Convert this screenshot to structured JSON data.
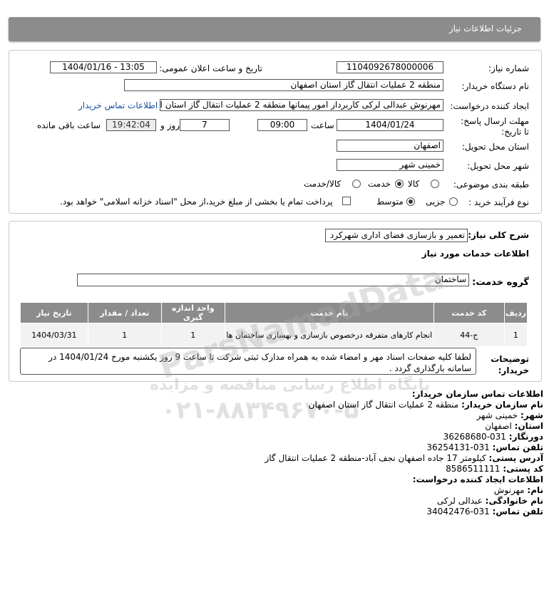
{
  "header": {
    "title": "جزئیات اطلاعات نیاز"
  },
  "form": {
    "need_number_label": "شماره نیاز:",
    "need_number": "1104092678000006",
    "announce_label": "تاریخ و ساعت اعلان عمومی:",
    "announce_value": "1404/01/16 - 13:05",
    "buyer_org_label": "نام دستگاه خریدار:",
    "buyer_org": "منطقه 2 عملیات انتقال گاز استان اصفهان",
    "creator_label": "ایجاد کننده درخواست:",
    "creator": "مهرنوش عبدالی لرکی کاربرداز امور پیمانها منطقه 2 عملیات انتقال گاز استان اص",
    "contact_link": "اطلاعات تماس خریدار",
    "deadline_label": "مهلت ارسال پاسخ: تا تاریخ:",
    "deadline_date": "1404/01/24",
    "time_label": "ساعت",
    "deadline_time": "09:00",
    "days_count": "7",
    "days_label": "روز و",
    "remaining_time": "19:42:04",
    "remaining_label": "ساعت باقی مانده",
    "province_label": "استان محل تحویل:",
    "province": "اصفهان",
    "city_label": "شهر محل تحویل:",
    "city": "خمینی شهر",
    "category_label": "طبقه بندی موضوعی:",
    "category_options": [
      "کالا",
      "خدمت",
      "کالا/خدمت"
    ],
    "category_selected": "خدمت",
    "process_label": "نوع فرآیند خرید :",
    "process_options": [
      "جزیی",
      "متوسط"
    ],
    "process_selected": "متوسط",
    "payment_text": "پرداخت تمام یا بخشی از مبلغ خرید،از محل \"اسناد خزانه اسلامی\" خواهد بود."
  },
  "summary": {
    "title_label": "شرح کلی نیاز:",
    "title_value": "تعمیر و بازسازی فضای اداری شهرکرد",
    "services_heading": "اطلاعات خدمات مورد نیاز",
    "group_label": "گروه خدمت:",
    "group_value": "ساختمان"
  },
  "table": {
    "headers": [
      "ردیف",
      "کد خدمت",
      "نام خدمت",
      "واحد اندازه گیری",
      "تعداد / مقدار",
      "تاریخ نیاز"
    ],
    "rows": [
      [
        "1",
        "ج-44",
        "انجام کارهای متفرقه درخصوص بازسازی و بهسازی ساختمان ها",
        "1",
        "1",
        "1404/03/31"
      ]
    ]
  },
  "notes": {
    "label": "توضیحات خریدار:",
    "text": "لطفا کلیه صفحات اسناد مهر و امضاء شده به همراه مدارک ثبتی شرکت تا ساعت 9 روز یکشنبه مورخ 1404/01/24 در سامانه بارگذاری گردد ."
  },
  "contact": {
    "heading": "اطلاعات تماس سازمان خریدار:",
    "org_label": "نام سازمان خریدار:",
    "org_value": "منطقه 2 عملیات انتقال گاز استان اصفهان",
    "city_label": "شهر:",
    "city_value": "خمینی شهر",
    "province_label": "استان:",
    "province_value": "اصفهان",
    "fax_label": "دورنگار:",
    "fax_value": "031-36268680",
    "phone_label": "تلفن تماس:",
    "phone_value": "031-36254131",
    "address_label": "آدرس پستی:",
    "address_value": "کیلومتر 17 جاده اصفهان نجف آباد-منطقه 2 عملیات انتقال گاز",
    "postal_label": "کد پستی:",
    "postal_value": "8586511111",
    "creator_heading": "اطلاعات ایجاد کننده درخواست:",
    "name_label": "نام:",
    "name_value": "مهرنوش",
    "family_label": "نام خانوادگی:",
    "family_value": "عبدالی لرکی",
    "creator_phone_label": "تلفن تماس:",
    "creator_phone_value": "031-34042476"
  },
  "watermark": {
    "brand": "ParsNamadData",
    "tagline": "پایگاه اطلاع رسانی مناقصه و مزایده",
    "phone": "۰۲۱-۸۸۳۴۹۶۷۰-۵"
  }
}
